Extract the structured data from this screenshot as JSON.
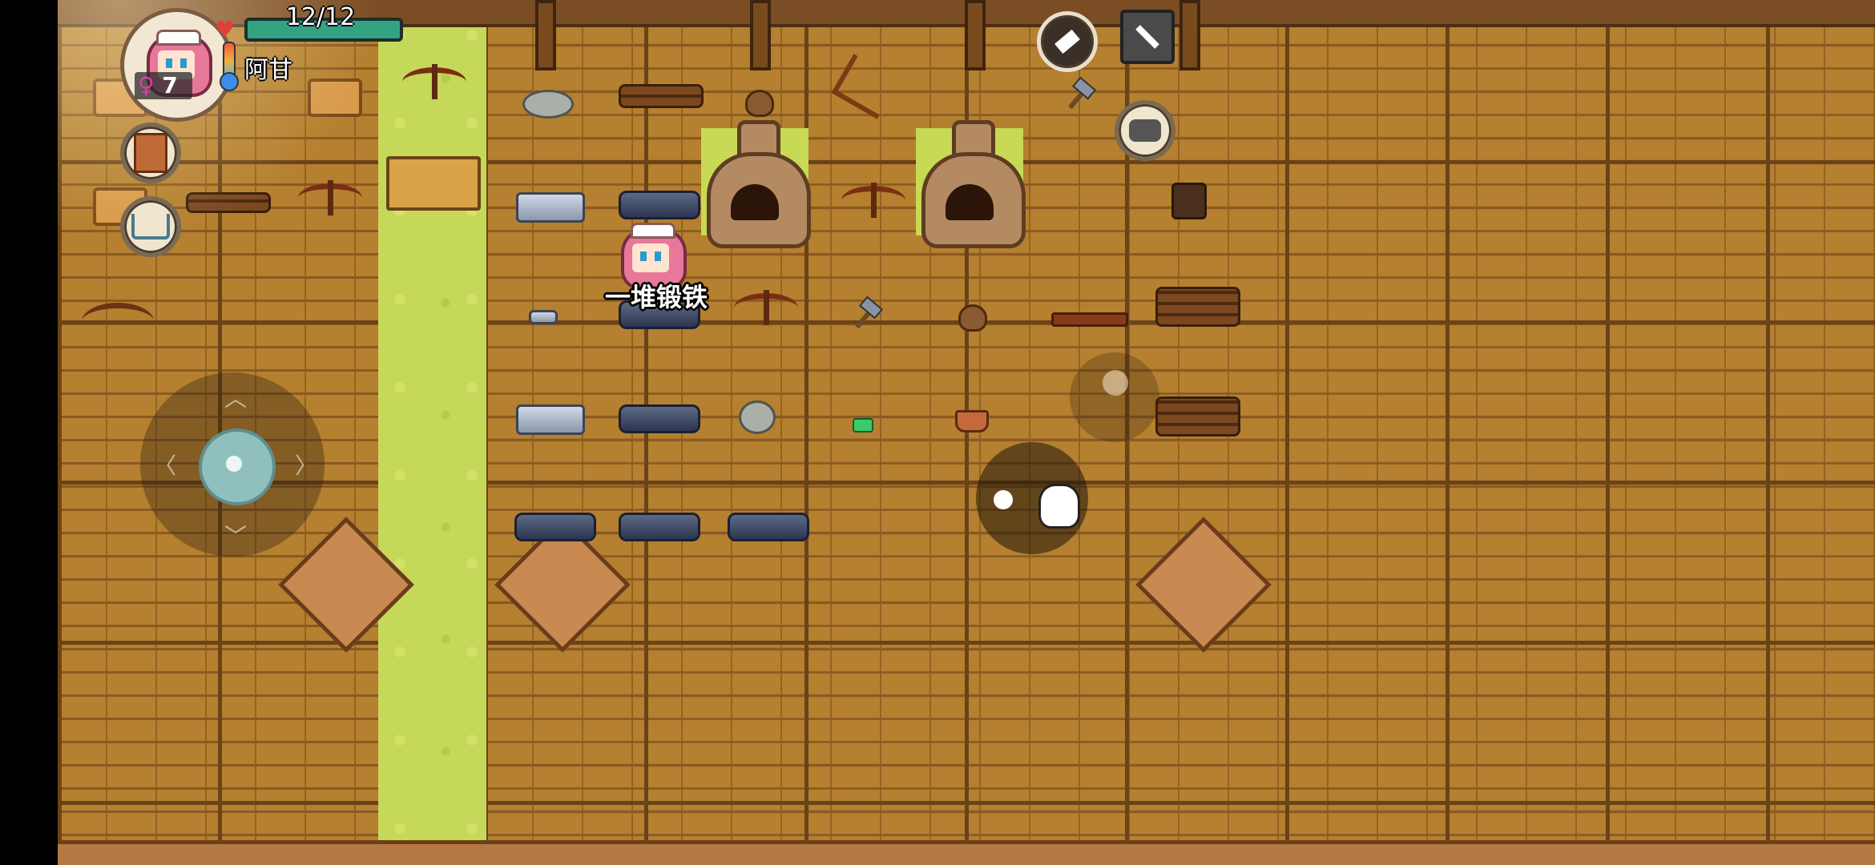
{
  "hud": {
    "hp_text": "12/12",
    "player_name": "阿甘",
    "gender_symbol": "♀",
    "level": "7"
  },
  "world": {
    "item_tooltip": "一堆锻铁"
  },
  "icons": {
    "heart": "heart-icon",
    "temperature": "thermometer-icon",
    "build": "hammer-icon",
    "settings": "wrench-icon",
    "chat": "speech-bubble-icon",
    "book": "book-icon",
    "shop": "shopping-cart-icon",
    "action": "pickup-hand-icon"
  },
  "colors": {
    "hp": "#33a384",
    "floor": "#b5802f",
    "grass": "#c6d85a",
    "gender": "#e03aa8"
  }
}
